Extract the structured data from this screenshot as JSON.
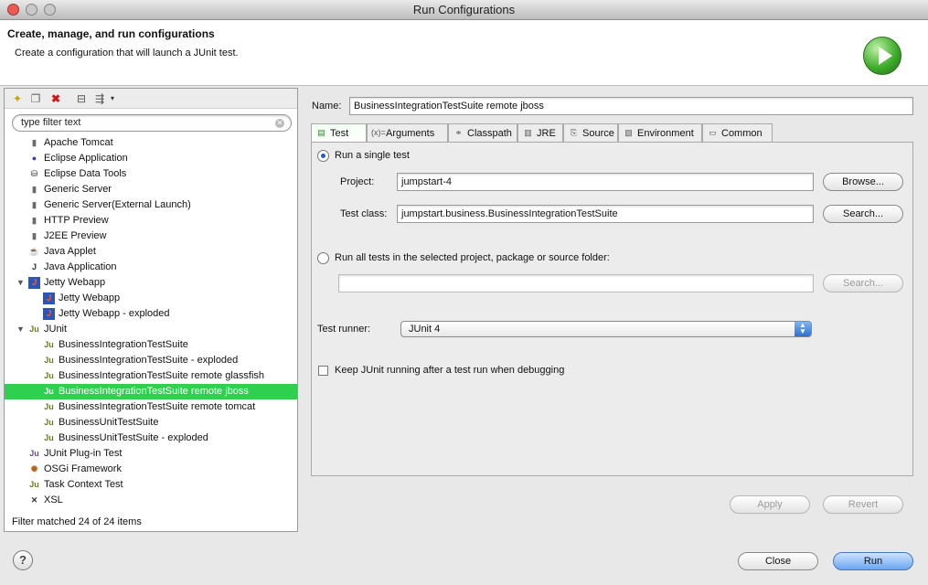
{
  "window": {
    "title": "Run Configurations"
  },
  "header": {
    "title": "Create, manage, and run configurations",
    "description": "Create a configuration that will launch a JUnit test."
  },
  "filter": {
    "value": "type filter text"
  },
  "tree": [
    {
      "label": "Apache Tomcat",
      "icon": "server-icon",
      "level": 1
    },
    {
      "label": "Eclipse Application",
      "icon": "eclipse-icon",
      "level": 1
    },
    {
      "label": "Eclipse Data Tools",
      "icon": "database-icon",
      "level": 1
    },
    {
      "label": "Generic Server",
      "icon": "server-icon",
      "level": 1
    },
    {
      "label": "Generic Server(External Launch)",
      "icon": "server-icon",
      "level": 1
    },
    {
      "label": "HTTP Preview",
      "icon": "server-icon",
      "level": 1
    },
    {
      "label": "J2EE Preview",
      "icon": "server-icon",
      "level": 1
    },
    {
      "label": "Java Applet",
      "icon": "applet-icon",
      "level": 1
    },
    {
      "label": "Java Application",
      "icon": "java-app-icon",
      "level": 1
    },
    {
      "label": "Jetty Webapp",
      "icon": "jetty-icon",
      "level": 1,
      "expanded": true
    },
    {
      "label": "Jetty Webapp",
      "icon": "jetty-icon",
      "level": 2
    },
    {
      "label": "Jetty Webapp - exploded",
      "icon": "jetty-icon",
      "level": 2
    },
    {
      "label": "JUnit",
      "icon": "junit-icon",
      "level": 1,
      "expanded": true
    },
    {
      "label": "BusinessIntegrationTestSuite",
      "icon": "junit-icon",
      "level": 2
    },
    {
      "label": "BusinessIntegrationTestSuite - exploded",
      "icon": "junit-icon",
      "level": 2
    },
    {
      "label": "BusinessIntegrationTestSuite remote glassfish",
      "icon": "junit-icon",
      "level": 2
    },
    {
      "label": "BusinessIntegrationTestSuite remote jboss",
      "icon": "junit-icon",
      "level": 2,
      "selected": true
    },
    {
      "label": "BusinessIntegrationTestSuite remote tomcat",
      "icon": "junit-icon",
      "level": 2
    },
    {
      "label": "BusinessUnitTestSuite",
      "icon": "junit-icon",
      "level": 2
    },
    {
      "label": "BusinessUnitTestSuite - exploded",
      "icon": "junit-icon",
      "level": 2
    },
    {
      "label": "JUnit Plug-in Test",
      "icon": "junit-plugin-icon",
      "level": 1
    },
    {
      "label": "OSGi Framework",
      "icon": "osgi-icon",
      "level": 1
    },
    {
      "label": "Task Context Test",
      "icon": "junit-icon",
      "level": 1
    },
    {
      "label": "XSL",
      "icon": "xsl-icon",
      "level": 1
    }
  ],
  "filter_status": "Filter matched 24 of 24 items",
  "name": {
    "label": "Name:",
    "value": "BusinessIntegrationTestSuite remote jboss"
  },
  "tabs": [
    "Test",
    "Arguments",
    "Classpath",
    "JRE",
    "Source",
    "Environment",
    "Common"
  ],
  "test": {
    "single_label": "Run a single test",
    "project_label": "Project:",
    "project_value": "jumpstart-4",
    "browse_label": "Browse...",
    "class_label": "Test class:",
    "class_value": "jumpstart.business.BusinessIntegrationTestSuite",
    "search_label": "Search...",
    "all_label": "Run all tests in the selected project, package or source folder:",
    "all_value": "",
    "search2_label": "Search...",
    "runner_label": "Test runner:",
    "runner_value": "JUnit 4",
    "keep_label": "Keep JUnit running after a test run when debugging"
  },
  "buttons": {
    "apply": "Apply",
    "revert": "Revert",
    "close": "Close",
    "run": "Run"
  }
}
